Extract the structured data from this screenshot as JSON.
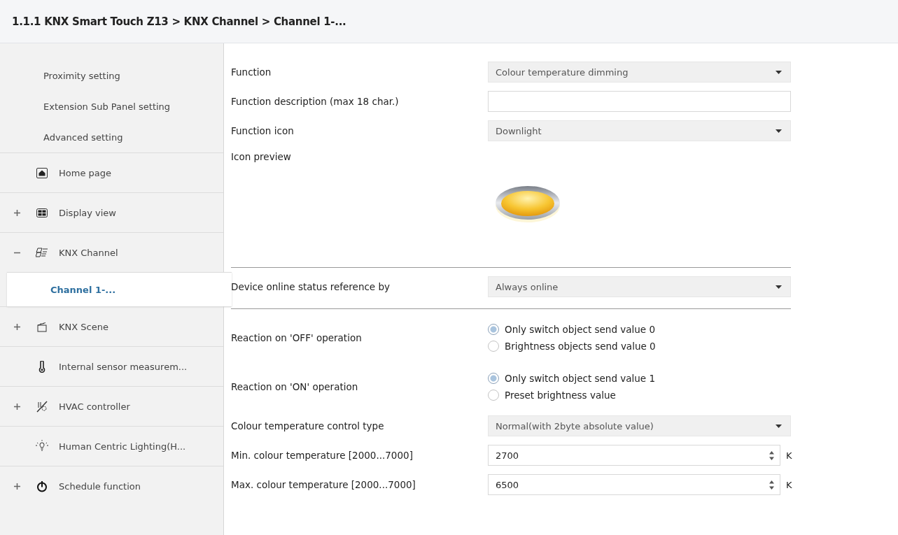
{
  "breadcrumb": "1.1.1 KNX Smart Touch Z13 > KNX Channel  > Channel 1-...",
  "sidebar": {
    "items": [
      {
        "kind": "sub",
        "label": "Proximity setting",
        "selected": false
      },
      {
        "kind": "sub",
        "label": "Extension Sub Panel setting",
        "selected": false
      },
      {
        "kind": "sub",
        "label": "Advanced setting",
        "selected": false
      },
      {
        "kind": "group",
        "label": "Home page",
        "expandable": false,
        "selected": false
      },
      {
        "kind": "group",
        "label": "Display view",
        "expandable": true,
        "expanded": false,
        "selected": false
      },
      {
        "kind": "group",
        "label": "KNX Channel",
        "expandable": true,
        "expanded": true,
        "selected": false
      },
      {
        "kind": "child",
        "label": "Channel 1-...",
        "selected": true
      },
      {
        "kind": "group",
        "label": "KNX Scene",
        "expandable": true,
        "expanded": false,
        "selected": false
      },
      {
        "kind": "group",
        "label": "Internal sensor measurem...",
        "expandable": false,
        "selected": false
      },
      {
        "kind": "group",
        "label": "HVAC controller",
        "expandable": true,
        "expanded": false,
        "selected": false
      },
      {
        "kind": "group",
        "label": "Human Centric Lighting(H...",
        "expandable": false,
        "selected": false
      },
      {
        "kind": "group",
        "label": "Schedule function",
        "expandable": true,
        "expanded": false,
        "selected": false
      }
    ]
  },
  "params": [
    {
      "kind": "select",
      "label": "Function",
      "value": "Colour temperature dimming"
    },
    {
      "kind": "text",
      "label": "Function description (max 18 char.)"
    },
    {
      "kind": "select",
      "label": "Function icon",
      "value": "Downlight"
    },
    {
      "kind": "preview",
      "label": "Icon preview"
    },
    {
      "kind": "separator"
    },
    {
      "kind": "select",
      "label": "Device online status reference by",
      "value": "Always online"
    },
    {
      "kind": "separator"
    },
    {
      "kind": "radio",
      "label": "Reaction on 'OFF' operation",
      "options": [
        {
          "label": "Only switch object send value 0",
          "selected": true
        },
        {
          "label": "Brightness objects send value 0",
          "selected": false
        }
      ]
    },
    {
      "kind": "radio",
      "label": "Reaction on 'ON' operation",
      "options": [
        {
          "label": "Only switch object send value 1",
          "selected": true
        },
        {
          "label": "Preset brightness value",
          "selected": false
        }
      ]
    },
    {
      "kind": "select",
      "label": "Colour temperature control type",
      "value": "Normal(with 2byte absolute value)"
    },
    {
      "kind": "spin",
      "label": "Min. colour temperature [2000...7000]",
      "value": "2700",
      "unit": "K"
    },
    {
      "kind": "spin",
      "label": "Max. colour temperature [2000...7000]",
      "value": "6500",
      "unit": "K"
    }
  ]
}
